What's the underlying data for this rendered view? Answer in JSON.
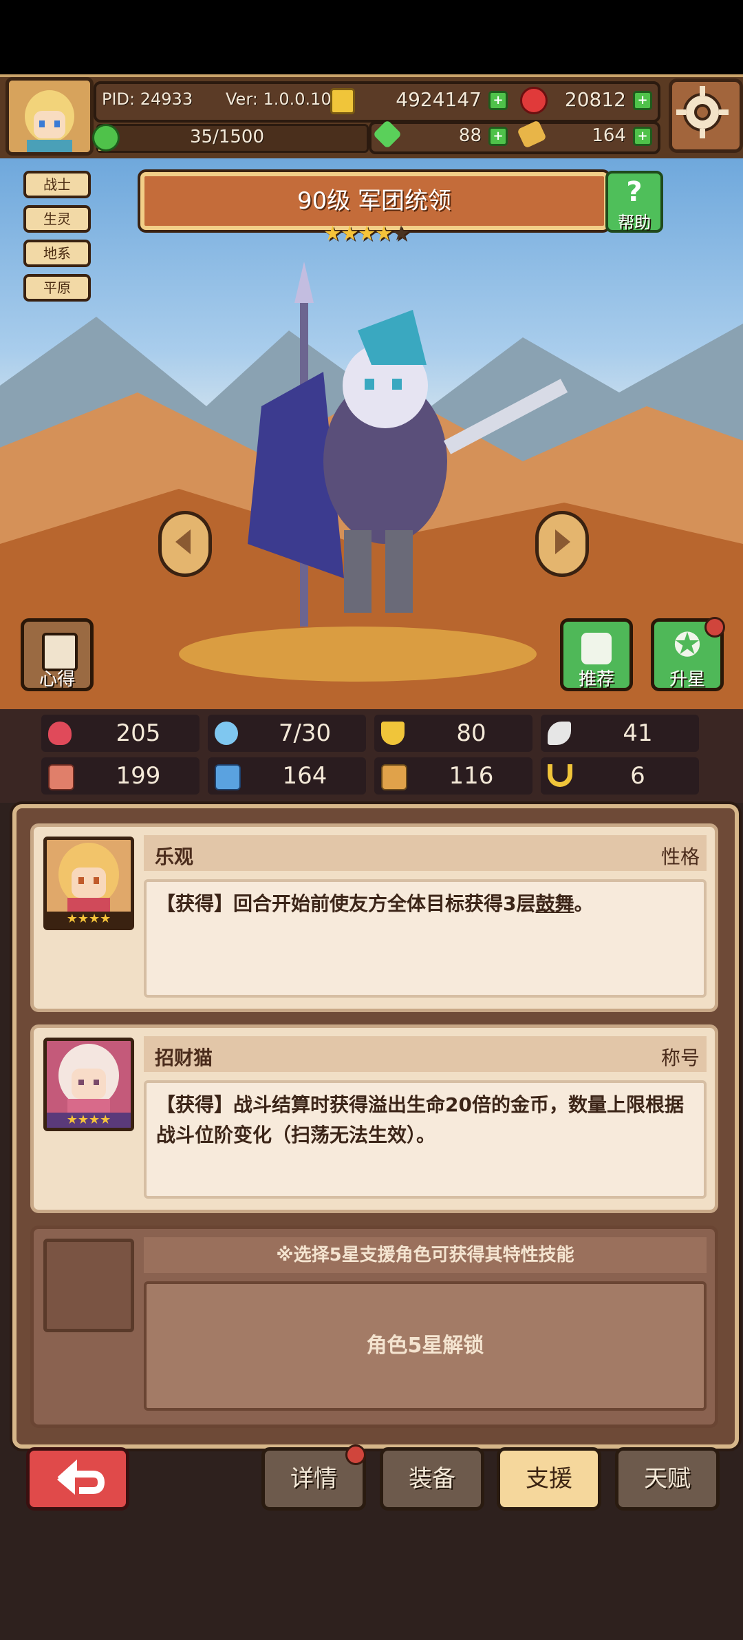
{
  "header": {
    "pid": "PID: 24933",
    "version": "Ver: 1.0.0.10",
    "gold": "4924147",
    "gems": "20812",
    "stamina": "35/1500",
    "clover": "88",
    "tickets": "164"
  },
  "tags": [
    "战士",
    "生灵",
    "地系",
    "平原"
  ],
  "character": {
    "title": "90级  军团统领",
    "stars_filled": 4,
    "stars_total": 5
  },
  "buttons": {
    "help": "帮助",
    "insight": "心得",
    "recommend": "推荐",
    "star_up": "升星"
  },
  "stats": [
    {
      "icon": "heart-icon",
      "value": "205",
      "color": "#e04a5a"
    },
    {
      "icon": "mana-drop-icon",
      "value": "7/30",
      "color": "#7fc7f0"
    },
    {
      "icon": "shield-icon",
      "value": "80",
      "color": "#f0c53a"
    },
    {
      "icon": "wing-icon",
      "value": "41",
      "color": "#e6e6e6"
    },
    {
      "icon": "fist-icon",
      "value": "199",
      "color": "#e07f6a"
    },
    {
      "icon": "book-icon",
      "value": "164",
      "color": "#5aa2e0"
    },
    {
      "icon": "scroll-icon",
      "value": "116",
      "color": "#e0a24a"
    },
    {
      "icon": "horseshoe-icon",
      "value": "6",
      "color": "#f0c53a"
    }
  ],
  "support": [
    {
      "name": "乐观",
      "kind": "性格",
      "desc_prefix": "【获得】回合开始前使友方全体目标获得3层",
      "desc_link": "鼓舞",
      "desc_suffix": "。",
      "stars": "★★★★"
    },
    {
      "name": "招财猫",
      "kind": "称号",
      "desc": "【获得】战斗结算时获得溢出生命20倍的金币，数量上限根据战斗位阶变化（扫荡无法生效）。",
      "stars": "★★★★"
    }
  ],
  "locked": {
    "hint": "※选择5星支援角色可获得其特性技能",
    "text": "角色5星解锁"
  },
  "nav": {
    "details": "详情",
    "equipment": "装备",
    "support": "支援",
    "talent": "天赋"
  }
}
